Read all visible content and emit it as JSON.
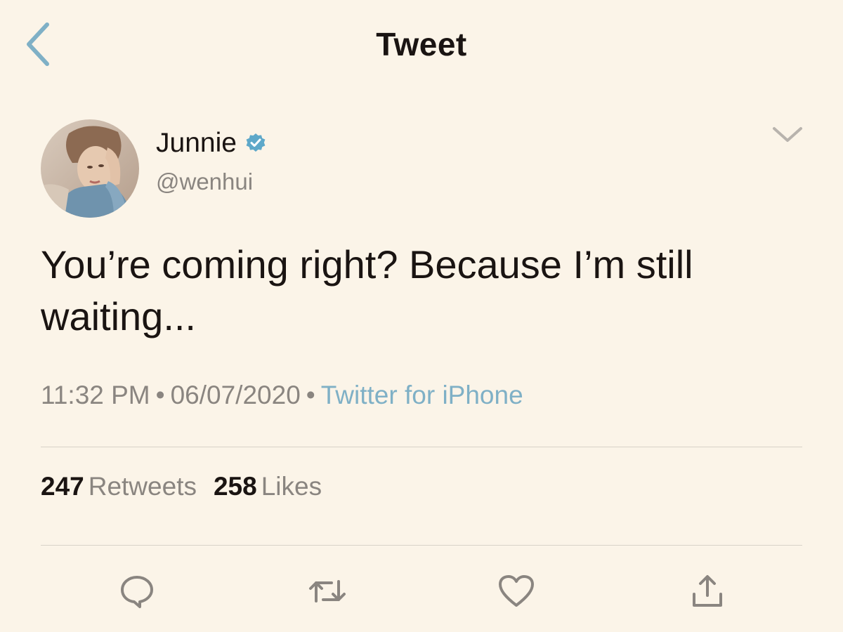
{
  "header": {
    "title": "Tweet",
    "back_icon": "chevron-left-icon"
  },
  "author": {
    "display_name": "Junnie",
    "handle": "@wenhui",
    "verified": true,
    "verified_color": "#5ea8c9"
  },
  "tweet": {
    "text": "You’re coming right? Because I’m still waiting...",
    "time": "11:32 PM",
    "date": "06/07/2020",
    "separator": "•",
    "source": "Twitter for iPhone"
  },
  "stats": {
    "retweets_count": "247",
    "retweets_label": "Retweets",
    "likes_count": "258",
    "likes_label": "Likes"
  },
  "actions": {
    "icons": [
      "reply-icon",
      "retweet-icon",
      "like-icon",
      "share-icon"
    ]
  },
  "colors": {
    "background": "#fbf4e8",
    "accent": "#7fb0c6",
    "muted_text": "#8a8580",
    "primary_text": "#1a1412"
  }
}
